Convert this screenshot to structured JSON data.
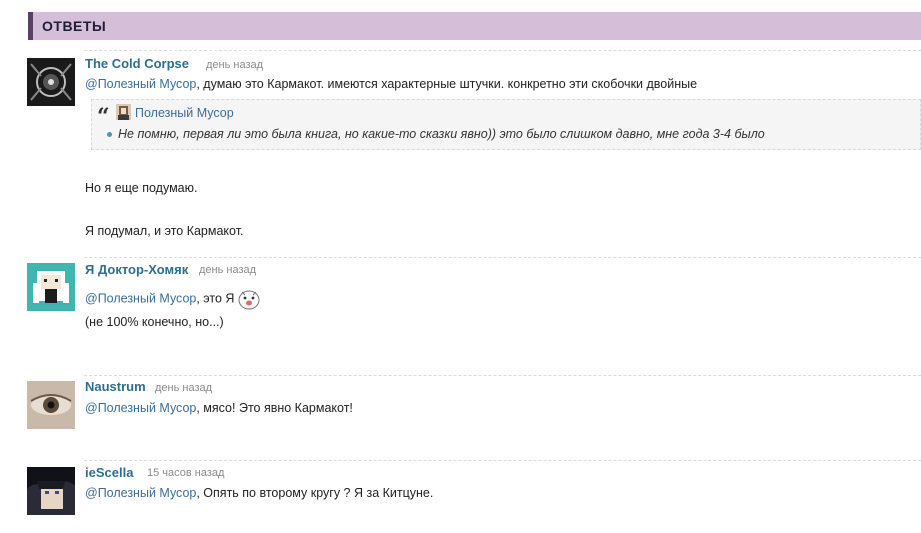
{
  "section": {
    "title": "ОТВЕТЫ"
  },
  "comments": [
    {
      "author": "The  Cold  Corpse",
      "time": "день назад",
      "mention": "@Полезный Мусор",
      "text": ", думаю это Кармакот. имеются характерные штучки. конкретно эти скобочки двойные",
      "quote": {
        "author": "Полезный Мусор",
        "text": "Не помню, первая ли это была книга, но какие-то сказки явно)) это было слишком давно, мне года 3-4 было"
      },
      "extra_lines": [
        "Но я еще подумаю.",
        "Я подумал, и это Кармакот."
      ]
    },
    {
      "author": "Я Доктор-Хомяк",
      "time": "день назад",
      "mention": "@Полезный Мусор",
      "text": ", это Я",
      "extra_lines": [
        "(не 100% конечно, но...)"
      ]
    },
    {
      "author": "Naustrum",
      "time": "день назад",
      "mention": "@Полезный Мусор",
      "text": ", мясо! Это явно Кармакот!"
    },
    {
      "author": "ieScella",
      "time": "15 часов назад",
      "mention": "@Полезный Мусор",
      "text": ", Опять по второму кругу ? Я за Китцуне."
    }
  ],
  "icons": [
    "quote-icon",
    "emoji-icon",
    "user-avatar"
  ],
  "colors": {
    "header_bg": "#d5bfd8",
    "header_accent": "#5a3f6a",
    "link": "#2e6e8e"
  }
}
